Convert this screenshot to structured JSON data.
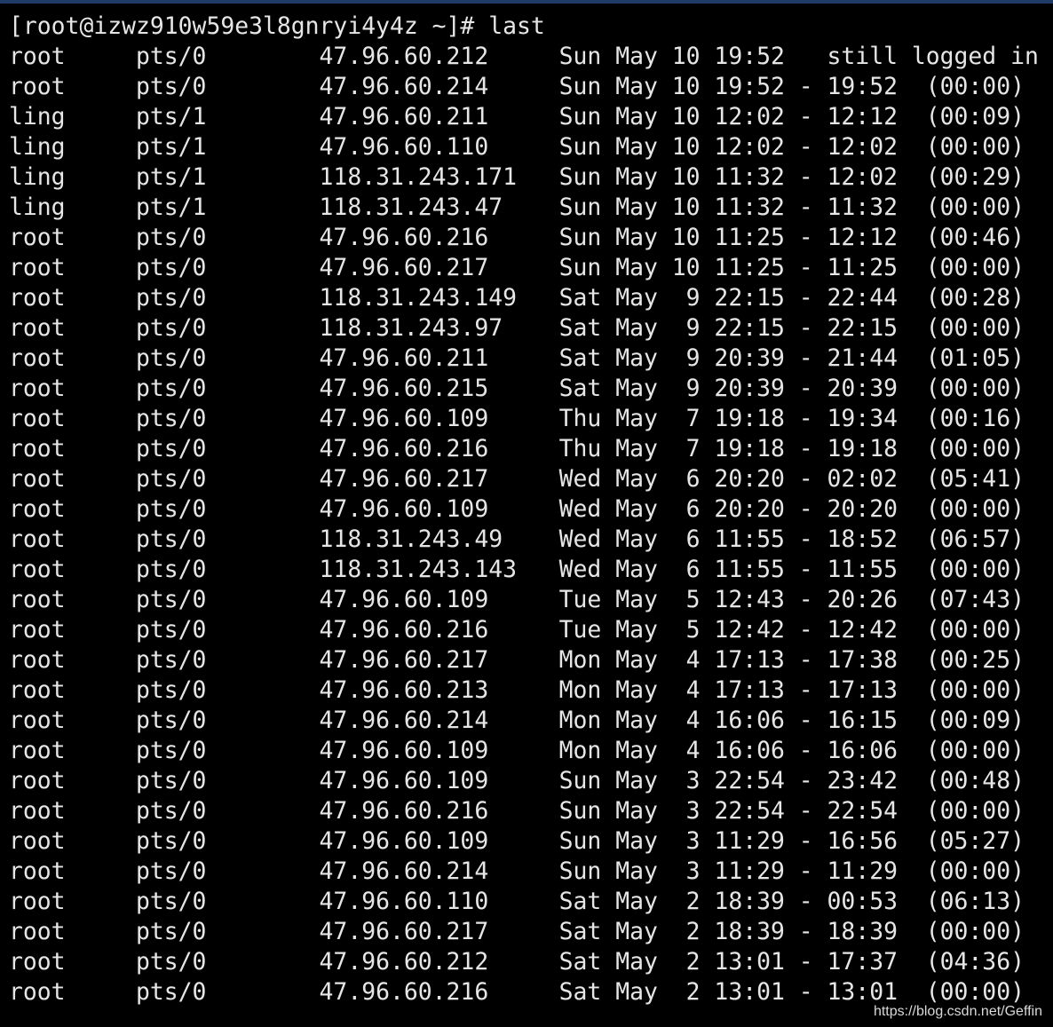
{
  "terminal": {
    "prompt": "[root@izwz910w59e3l8gnryi4y4z ~]# last",
    "rows": [
      {
        "user": "root",
        "tty": "pts/0",
        "host": "47.96.60.212",
        "day": "Sun",
        "month": "May",
        "date": "10",
        "login": "19:52",
        "logout": "still",
        "duration": "logged in"
      },
      {
        "user": "root",
        "tty": "pts/0",
        "host": "47.96.60.214",
        "day": "Sun",
        "month": "May",
        "date": "10",
        "login": "19:52",
        "logout": "19:52",
        "duration": "(00:00)"
      },
      {
        "user": "ling",
        "tty": "pts/1",
        "host": "47.96.60.211",
        "day": "Sun",
        "month": "May",
        "date": "10",
        "login": "12:02",
        "logout": "12:12",
        "duration": "(00:09)"
      },
      {
        "user": "ling",
        "tty": "pts/1",
        "host": "47.96.60.110",
        "day": "Sun",
        "month": "May",
        "date": "10",
        "login": "12:02",
        "logout": "12:02",
        "duration": "(00:00)"
      },
      {
        "user": "ling",
        "tty": "pts/1",
        "host": "118.31.243.171",
        "day": "Sun",
        "month": "May",
        "date": "10",
        "login": "11:32",
        "logout": "12:02",
        "duration": "(00:29)"
      },
      {
        "user": "ling",
        "tty": "pts/1",
        "host": "118.31.243.47",
        "day": "Sun",
        "month": "May",
        "date": "10",
        "login": "11:32",
        "logout": "11:32",
        "duration": "(00:00)"
      },
      {
        "user": "root",
        "tty": "pts/0",
        "host": "47.96.60.216",
        "day": "Sun",
        "month": "May",
        "date": "10",
        "login": "11:25",
        "logout": "12:12",
        "duration": "(00:46)"
      },
      {
        "user": "root",
        "tty": "pts/0",
        "host": "47.96.60.217",
        "day": "Sun",
        "month": "May",
        "date": "10",
        "login": "11:25",
        "logout": "11:25",
        "duration": "(00:00)"
      },
      {
        "user": "root",
        "tty": "pts/0",
        "host": "118.31.243.149",
        "day": "Sat",
        "month": "May",
        "date": "9",
        "login": "22:15",
        "logout": "22:44",
        "duration": "(00:28)"
      },
      {
        "user": "root",
        "tty": "pts/0",
        "host": "118.31.243.97",
        "day": "Sat",
        "month": "May",
        "date": "9",
        "login": "22:15",
        "logout": "22:15",
        "duration": "(00:00)"
      },
      {
        "user": "root",
        "tty": "pts/0",
        "host": "47.96.60.211",
        "day": "Sat",
        "month": "May",
        "date": "9",
        "login": "20:39",
        "logout": "21:44",
        "duration": "(01:05)"
      },
      {
        "user": "root",
        "tty": "pts/0",
        "host": "47.96.60.215",
        "day": "Sat",
        "month": "May",
        "date": "9",
        "login": "20:39",
        "logout": "20:39",
        "duration": "(00:00)"
      },
      {
        "user": "root",
        "tty": "pts/0",
        "host": "47.96.60.109",
        "day": "Thu",
        "month": "May",
        "date": "7",
        "login": "19:18",
        "logout": "19:34",
        "duration": "(00:16)"
      },
      {
        "user": "root",
        "tty": "pts/0",
        "host": "47.96.60.216",
        "day": "Thu",
        "month": "May",
        "date": "7",
        "login": "19:18",
        "logout": "19:18",
        "duration": "(00:00)"
      },
      {
        "user": "root",
        "tty": "pts/0",
        "host": "47.96.60.217",
        "day": "Wed",
        "month": "May",
        "date": "6",
        "login": "20:20",
        "logout": "02:02",
        "duration": "(05:41)"
      },
      {
        "user": "root",
        "tty": "pts/0",
        "host": "47.96.60.109",
        "day": "Wed",
        "month": "May",
        "date": "6",
        "login": "20:20",
        "logout": "20:20",
        "duration": "(00:00)"
      },
      {
        "user": "root",
        "tty": "pts/0",
        "host": "118.31.243.49",
        "day": "Wed",
        "month": "May",
        "date": "6",
        "login": "11:55",
        "logout": "18:52",
        "duration": "(06:57)"
      },
      {
        "user": "root",
        "tty": "pts/0",
        "host": "118.31.243.143",
        "day": "Wed",
        "month": "May",
        "date": "6",
        "login": "11:55",
        "logout": "11:55",
        "duration": "(00:00)"
      },
      {
        "user": "root",
        "tty": "pts/0",
        "host": "47.96.60.109",
        "day": "Tue",
        "month": "May",
        "date": "5",
        "login": "12:43",
        "logout": "20:26",
        "duration": "(07:43)"
      },
      {
        "user": "root",
        "tty": "pts/0",
        "host": "47.96.60.216",
        "day": "Tue",
        "month": "May",
        "date": "5",
        "login": "12:42",
        "logout": "12:42",
        "duration": "(00:00)"
      },
      {
        "user": "root",
        "tty": "pts/0",
        "host": "47.96.60.217",
        "day": "Mon",
        "month": "May",
        "date": "4",
        "login": "17:13",
        "logout": "17:38",
        "duration": "(00:25)"
      },
      {
        "user": "root",
        "tty": "pts/0",
        "host": "47.96.60.213",
        "day": "Mon",
        "month": "May",
        "date": "4",
        "login": "17:13",
        "logout": "17:13",
        "duration": "(00:00)"
      },
      {
        "user": "root",
        "tty": "pts/0",
        "host": "47.96.60.214",
        "day": "Mon",
        "month": "May",
        "date": "4",
        "login": "16:06",
        "logout": "16:15",
        "duration": "(00:09)"
      },
      {
        "user": "root",
        "tty": "pts/0",
        "host": "47.96.60.109",
        "day": "Mon",
        "month": "May",
        "date": "4",
        "login": "16:06",
        "logout": "16:06",
        "duration": "(00:00)"
      },
      {
        "user": "root",
        "tty": "pts/0",
        "host": "47.96.60.109",
        "day": "Sun",
        "month": "May",
        "date": "3",
        "login": "22:54",
        "logout": "23:42",
        "duration": "(00:48)"
      },
      {
        "user": "root",
        "tty": "pts/0",
        "host": "47.96.60.216",
        "day": "Sun",
        "month": "May",
        "date": "3",
        "login": "22:54",
        "logout": "22:54",
        "duration": "(00:00)"
      },
      {
        "user": "root",
        "tty": "pts/0",
        "host": "47.96.60.109",
        "day": "Sun",
        "month": "May",
        "date": "3",
        "login": "11:29",
        "logout": "16:56",
        "duration": "(05:27)"
      },
      {
        "user": "root",
        "tty": "pts/0",
        "host": "47.96.60.214",
        "day": "Sun",
        "month": "May",
        "date": "3",
        "login": "11:29",
        "logout": "11:29",
        "duration": "(00:00)"
      },
      {
        "user": "root",
        "tty": "pts/0",
        "host": "47.96.60.110",
        "day": "Sat",
        "month": "May",
        "date": "2",
        "login": "18:39",
        "logout": "00:53",
        "duration": "(06:13)"
      },
      {
        "user": "root",
        "tty": "pts/0",
        "host": "47.96.60.217",
        "day": "Sat",
        "month": "May",
        "date": "2",
        "login": "18:39",
        "logout": "18:39",
        "duration": "(00:00)"
      },
      {
        "user": "root",
        "tty": "pts/0",
        "host": "47.96.60.212",
        "day": "Sat",
        "month": "May",
        "date": "2",
        "login": "13:01",
        "logout": "17:37",
        "duration": "(04:36)"
      },
      {
        "user": "root",
        "tty": "pts/0",
        "host": "47.96.60.216",
        "day": "Sat",
        "month": "May",
        "date": "2",
        "login": "13:01",
        "logout": "13:01",
        "duration": "(00:00)"
      }
    ]
  },
  "watermark": "https://blog.csdn.net/Geffin",
  "colors": {
    "background": "#000000",
    "foreground": "#e6e6e6",
    "accent": "#1e3a66"
  }
}
